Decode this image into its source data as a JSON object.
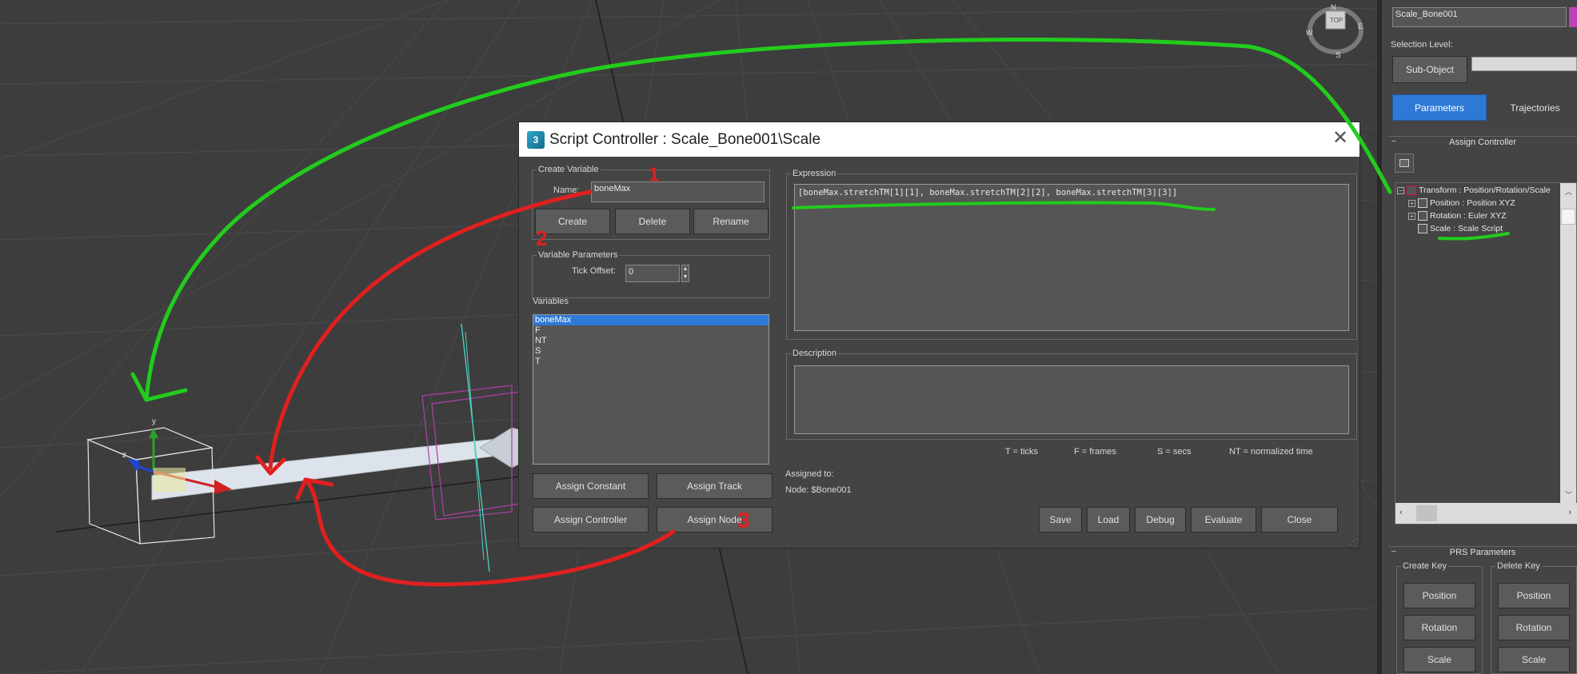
{
  "viewport": {
    "gizmo": {
      "top": "TOP",
      "n": "N",
      "e": "E",
      "w": "W",
      "s": "S"
    },
    "axis_y": "y",
    "axis_z": "z"
  },
  "dialog": {
    "title": "Script Controller : Scale_Bone001\\Scale",
    "create_variable": {
      "legend": "Create Variable",
      "name_label": "Name:",
      "name_value": "boneMax",
      "create": "Create",
      "delete": "Delete",
      "rename": "Rename"
    },
    "variable_parameters": {
      "legend": "Variable Parameters",
      "tick_offset_label": "Tick Offset:",
      "tick_offset_value": "0"
    },
    "variables": {
      "label": "Variables",
      "items": [
        "boneMax",
        "F",
        "NT",
        "S",
        "T"
      ],
      "selected": "boneMax"
    },
    "assign": {
      "constant": "Assign Constant",
      "track": "Assign Track",
      "controller": "Assign Controller",
      "node": "Assign Node"
    },
    "expression": {
      "legend": "Expression",
      "value": "[boneMax.stretchTM[1][1], boneMax.stretchTM[2][2], boneMax.stretchTM[3][3]]"
    },
    "description": {
      "legend": "Description",
      "value": ""
    },
    "legend_keys": {
      "t": "T = ticks",
      "f": "F = frames",
      "s": "S = secs",
      "nt": "NT = normalized time"
    },
    "assigned_to": {
      "label": "Assigned to:",
      "node": "Node: $Bone001"
    },
    "buttons": {
      "save": "Save",
      "load": "Load",
      "debug": "Debug",
      "evaluate": "Evaluate",
      "close": "Close"
    }
  },
  "annotations": {
    "one": "1",
    "two": "2",
    "three": "3"
  },
  "right_panel": {
    "object_name": "Scale_Bone001",
    "selection_level_label": "Selection Level:",
    "sub_object": "Sub-Object",
    "tabs": {
      "parameters": "Parameters",
      "trajectories": "Trajectories"
    },
    "assign_controller": "Assign Controller",
    "tree": [
      "Transform : Position/Rotation/Scale",
      "Position : Position XYZ",
      "Rotation : Euler XYZ",
      "Scale : Scale Script"
    ],
    "prs_parameters": "PRS Parameters",
    "create_key": {
      "label": "Create Key",
      "position": "Position",
      "rotation": "Rotation",
      "scale": "Scale"
    },
    "delete_key": {
      "label": "Delete Key",
      "position": "Position",
      "rotation": "Rotation",
      "scale": "Scale"
    },
    "accent_color": "#2f79d6"
  }
}
